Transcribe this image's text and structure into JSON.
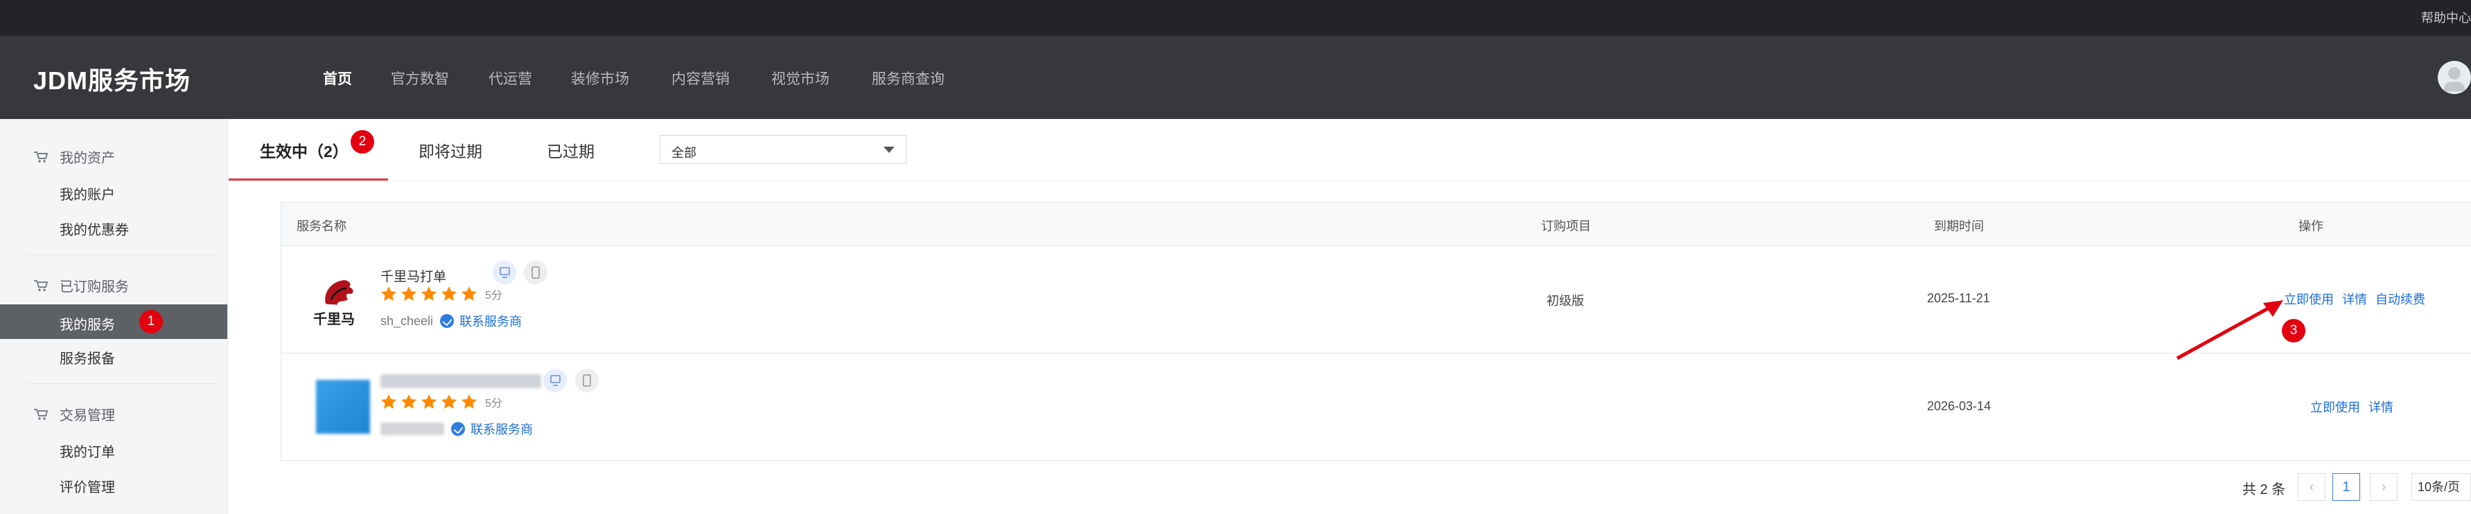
{
  "topbar": {
    "help_label": "帮助中心"
  },
  "header": {
    "logo": "JDM服务市场",
    "nav": [
      "首页",
      "官方数智",
      "代运营",
      "装修市场",
      "内容营销",
      "视觉市场",
      "服务商查询"
    ]
  },
  "sidebar": {
    "groups": [
      {
        "title": "我的资产",
        "items": [
          "我的账户",
          "我的优惠券"
        ]
      },
      {
        "title": "已订购服务",
        "items": [
          "我的服务",
          "服务报备"
        ]
      },
      {
        "title": "交易管理",
        "items": [
          "我的订单",
          "评价管理"
        ]
      }
    ],
    "active_item": "我的服务"
  },
  "tabs": {
    "items": [
      "生效中（2）",
      "即将过期",
      "已过期"
    ],
    "active_index": 0
  },
  "filter": {
    "value": "全部"
  },
  "table": {
    "headers": [
      "服务名称",
      "订购项目",
      "到期时间",
      "操作"
    ],
    "rows": [
      {
        "name": "千里马打单",
        "logo_text": "千里马",
        "rating": 5,
        "score_label": "5分",
        "vendor": "sh_cheeli",
        "contact_label": "联系服务商",
        "item": "初级版",
        "expire": "2025-11-21",
        "actions": [
          "立即使用",
          "详情",
          "自动续费"
        ]
      },
      {
        "name": "",
        "rating": 5,
        "score_label": "5分",
        "vendor": "",
        "contact_label": "联系服务商",
        "item": "",
        "expire": "2026-03-14",
        "actions": [
          "立即使用",
          "详情"
        ]
      }
    ]
  },
  "pagination": {
    "total_label": "共 2 条",
    "current_page": "1",
    "page_size": "10条/页"
  },
  "annotations": {
    "badges": [
      "1",
      "2",
      "3"
    ],
    "arrow_color": "#e3000f"
  },
  "colors": {
    "accent_red": "#e4393c",
    "link_blue": "#1e6fd9",
    "star_orange": "#ff8a00",
    "header_bg": "#36383c"
  }
}
